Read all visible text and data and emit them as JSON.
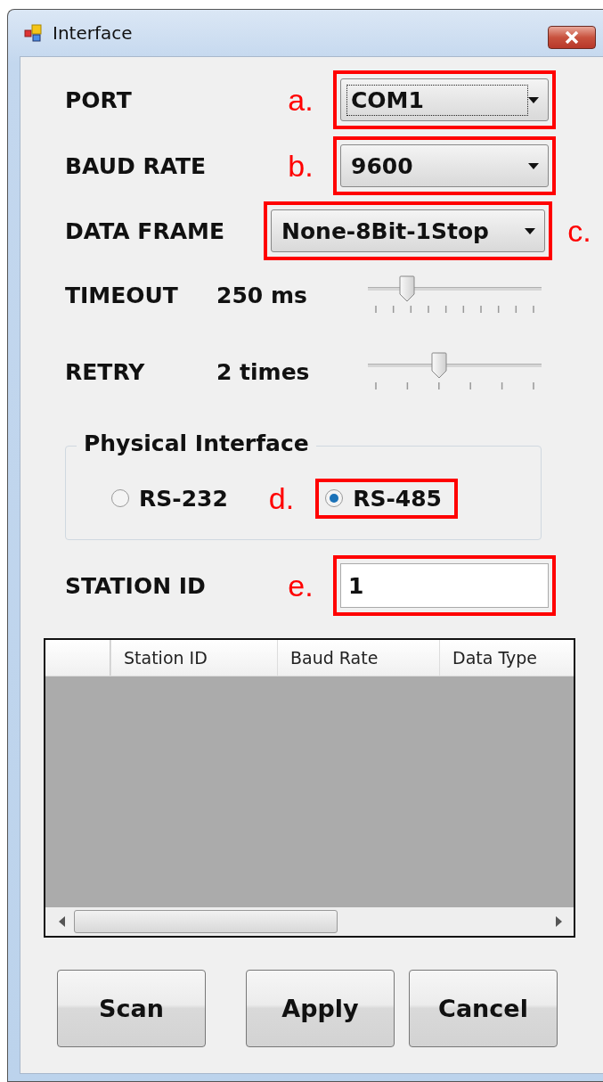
{
  "window": {
    "title": "Interface"
  },
  "settings": [
    {
      "label": "PORT",
      "value": "COM1",
      "annotation": "a.",
      "focused": true
    },
    {
      "label": "BAUD RATE",
      "value": "9600",
      "annotation": "b.",
      "focused": false
    },
    {
      "label": "DATA FRAME",
      "value": "None-8Bit-1Stop",
      "annotation": "c.",
      "focused": false
    }
  ],
  "sliders": [
    {
      "label": "TIMEOUT",
      "reading": "250 ms",
      "level": 0.2,
      "kind": "fine"
    },
    {
      "label": "RETRY",
      "reading": "2 times",
      "level": 0.4,
      "kind": "coarse"
    }
  ],
  "physical_interface": {
    "title": "Physical Interface",
    "options": [
      {
        "label": "RS-232",
        "selected": false
      },
      {
        "label": "RS-485",
        "selected": true,
        "annotation": "d."
      }
    ]
  },
  "station": {
    "label": "STATION ID",
    "value": "1",
    "annotation": "e."
  },
  "table": {
    "columns": [
      "Station ID",
      "Baud Rate",
      "Data Type"
    ]
  },
  "buttons": [
    "Scan",
    "Apply",
    "Cancel"
  ]
}
